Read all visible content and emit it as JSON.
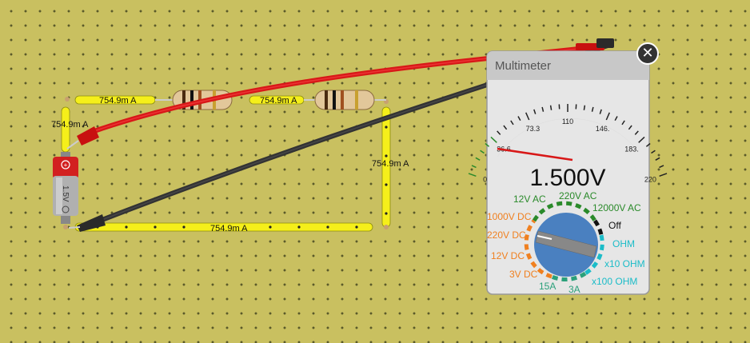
{
  "circuit": {
    "wire_current": "754.9m A",
    "battery_label": "1.5V",
    "wire_labels": [
      {
        "id": "top-left",
        "text": "754.9m A"
      },
      {
        "id": "top-mid",
        "text": "754.9m A"
      },
      {
        "id": "left",
        "text": "754.9m A"
      },
      {
        "id": "right",
        "text": "754.9m A"
      },
      {
        "id": "bottom",
        "text": "754.9m A"
      }
    ]
  },
  "multimeter": {
    "title": "Multimeter",
    "reading": "1.500V",
    "close_icon": "close-icon",
    "scale_labels": [
      "0",
      "36.6",
      "73.3",
      "110",
      "146.",
      "183.",
      "220"
    ],
    "dial_options": [
      {
        "label": "12V AC",
        "color": "#2a8a2a"
      },
      {
        "label": "220V AC",
        "color": "#2a8a2a"
      },
      {
        "label": "12000V AC",
        "color": "#2a8a2a"
      },
      {
        "label": "Off",
        "color": "#111111"
      },
      {
        "label": "OHM",
        "color": "#1bbcc8"
      },
      {
        "label": "x10 OHM",
        "color": "#1bbcc8"
      },
      {
        "label": "x100 OHM",
        "color": "#1bbcc8"
      },
      {
        "label": "1000V DC",
        "color": "#f08020"
      },
      {
        "label": "220V DC",
        "color": "#f08020"
      },
      {
        "label": "12V DC",
        "color": "#f08020"
      },
      {
        "label": "3V DC",
        "color": "#f08020"
      },
      {
        "label": "15A",
        "color": "#2aa07a"
      },
      {
        "label": "3A",
        "color": "#2aa07a"
      }
    ],
    "selected_option": "3V DC"
  },
  "colors": {
    "board": "#c9c060",
    "wire": "#f5ef1a",
    "probe_red": "#d81818",
    "probe_black": "#333333",
    "dial": "#4a80c0"
  }
}
